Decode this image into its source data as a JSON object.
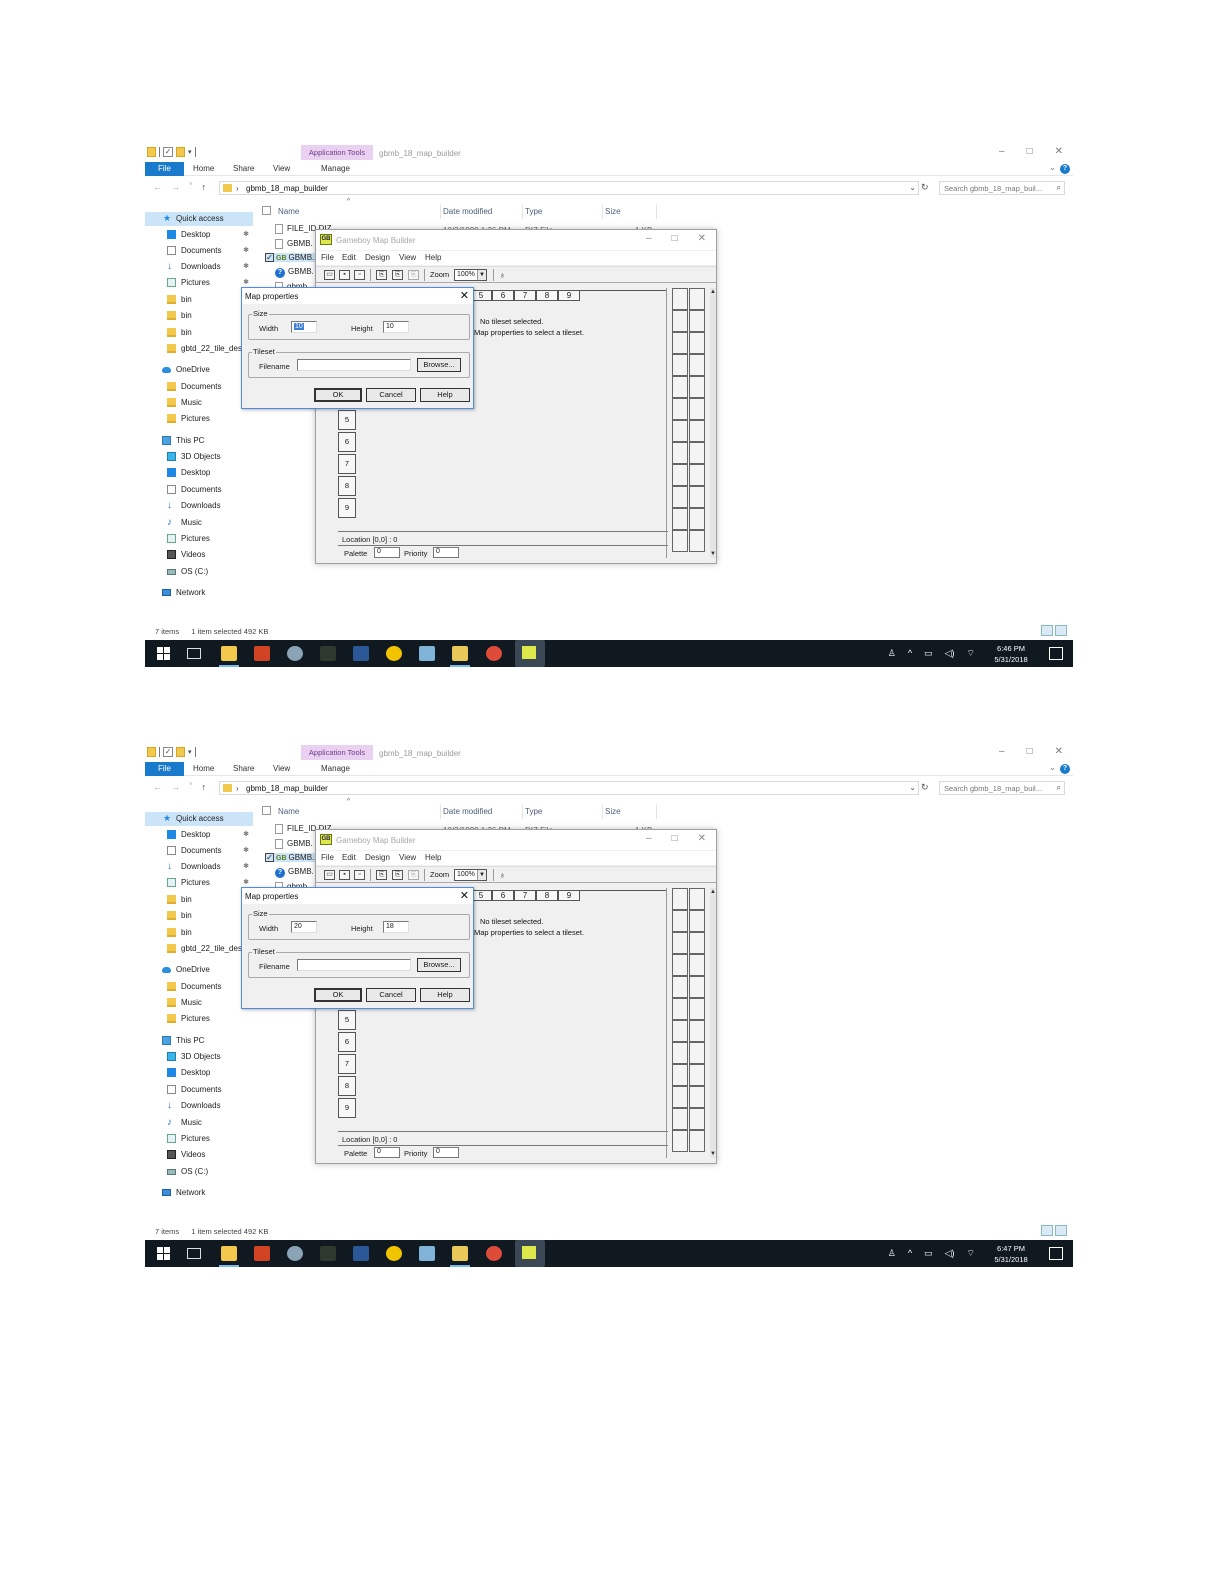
{
  "explorer": {
    "window_title": "gbmb_18_map_builder",
    "application_tools": "Application Tools",
    "ribbon_tabs": [
      "File",
      "Home",
      "Share",
      "View",
      "Manage"
    ],
    "address_path": "gbmb_18_map_builder",
    "search_placeholder": "Search gbmb_18_map_buil...",
    "columns": [
      "Name",
      "Date modified",
      "Type",
      "Size"
    ],
    "files": [
      {
        "name": "FILE_ID.DIZ",
        "date": "10/3/1999 1:26 PM",
        "type": "DIZ File",
        "size": "1 KB"
      },
      {
        "name": "GBMB.",
        "date": "",
        "type": "",
        "size": ""
      },
      {
        "name": "GBMB.",
        "date": "",
        "type": "",
        "size": ""
      },
      {
        "name": "GBMB.",
        "date": "",
        "type": "",
        "size": ""
      },
      {
        "name": "gbmb",
        "date": "",
        "type": "",
        "size": ""
      }
    ],
    "nav": {
      "quick_access": "Quick access",
      "quick_items": [
        "Desktop",
        "Documents",
        "Downloads",
        "Pictures",
        "bin",
        "bin",
        "bin",
        "gbtd_22_tile_des"
      ],
      "onedrive": "OneDrive",
      "onedrive_items": [
        "Documents",
        "Music",
        "Pictures"
      ],
      "this_pc": "This PC",
      "pc_items": [
        "3D Objects",
        "Desktop",
        "Documents",
        "Downloads",
        "Music",
        "Pictures",
        "Videos",
        "OS (C:)"
      ],
      "network": "Network"
    },
    "status": {
      "items": "7 items",
      "selected": "1 item selected  492 KB"
    }
  },
  "gbmb": {
    "title": "Gameboy Map Builder",
    "menu": [
      "File",
      "Edit",
      "Design",
      "View",
      "Help"
    ],
    "zoom_label": "Zoom",
    "zoom_value": "100%",
    "col_headers": [
      "5",
      "6",
      "7",
      "8",
      "9"
    ],
    "row_headers": [
      "5",
      "6",
      "7",
      "8",
      "9"
    ],
    "message_line1": "No tileset selected.",
    "message_line2": "Map properties to select a tileset.",
    "location": "Location  [0,0] : 0",
    "palette_label": "Palette",
    "palette_value": "0",
    "priority_label": "Priority",
    "priority_value": "0"
  },
  "dialog": {
    "title": "Map properties",
    "size_group": "Size",
    "width_label": "Width",
    "height_label": "Height",
    "tileset_group": "Tileset",
    "filename_label": "Filename",
    "filename_value": "",
    "browse": "Browse...",
    "ok": "OK",
    "cancel": "Cancel",
    "help": "Help"
  },
  "shots": [
    {
      "width_value": "10",
      "height_value": "10",
      "clock_time": "6:46 PM",
      "clock_date": "5/31/2018"
    },
    {
      "width_value": "20",
      "height_value": "18",
      "clock_time": "6:47 PM",
      "clock_date": "5/31/2018"
    }
  ],
  "colors": {
    "accent": "#1979ca",
    "app_tools": "#ead1f2",
    "taskbar": "#101820",
    "dialog_border": "#4f8be0"
  }
}
